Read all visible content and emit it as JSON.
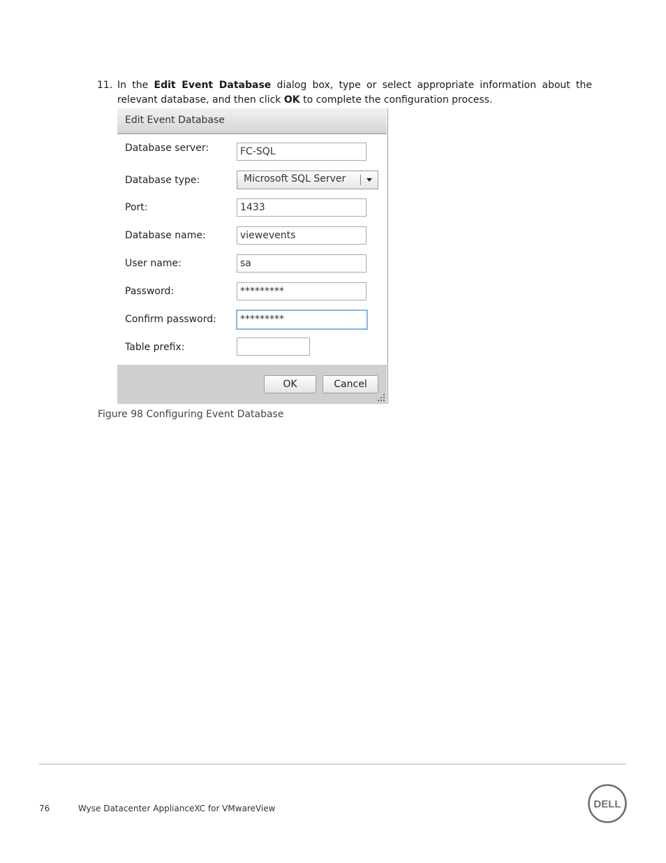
{
  "step": {
    "number": "11.",
    "text_before": "In the ",
    "dialog_name": "Edit Event Database",
    "text_middle": " dialog box, type or select appropriate information about the relevant database, and then click ",
    "ok_word": "OK",
    "text_after": " to complete the configuration process."
  },
  "dialog": {
    "title": "Edit Event Database",
    "labels": {
      "server": "Database server:",
      "type": "Database type:",
      "port": "Port:",
      "name": "Database name:",
      "user": "User name:",
      "password": "Password:",
      "confirm": "Confirm password:",
      "prefix": "Table prefix:"
    },
    "values": {
      "server": "FC-SQL",
      "type": "Microsoft SQL Server",
      "port": "1433",
      "name": "viewevents",
      "user": "sa",
      "password": "*********",
      "confirm": "*********",
      "prefix": ""
    },
    "buttons": {
      "ok": "OK",
      "cancel": "Cancel"
    }
  },
  "caption": "Figure 98  Configuring Event Database",
  "footer": {
    "page_number": "76",
    "doc_title": "Wyse Datacenter ApplianceXC for VMwareView",
    "logo_text": "DELL"
  }
}
